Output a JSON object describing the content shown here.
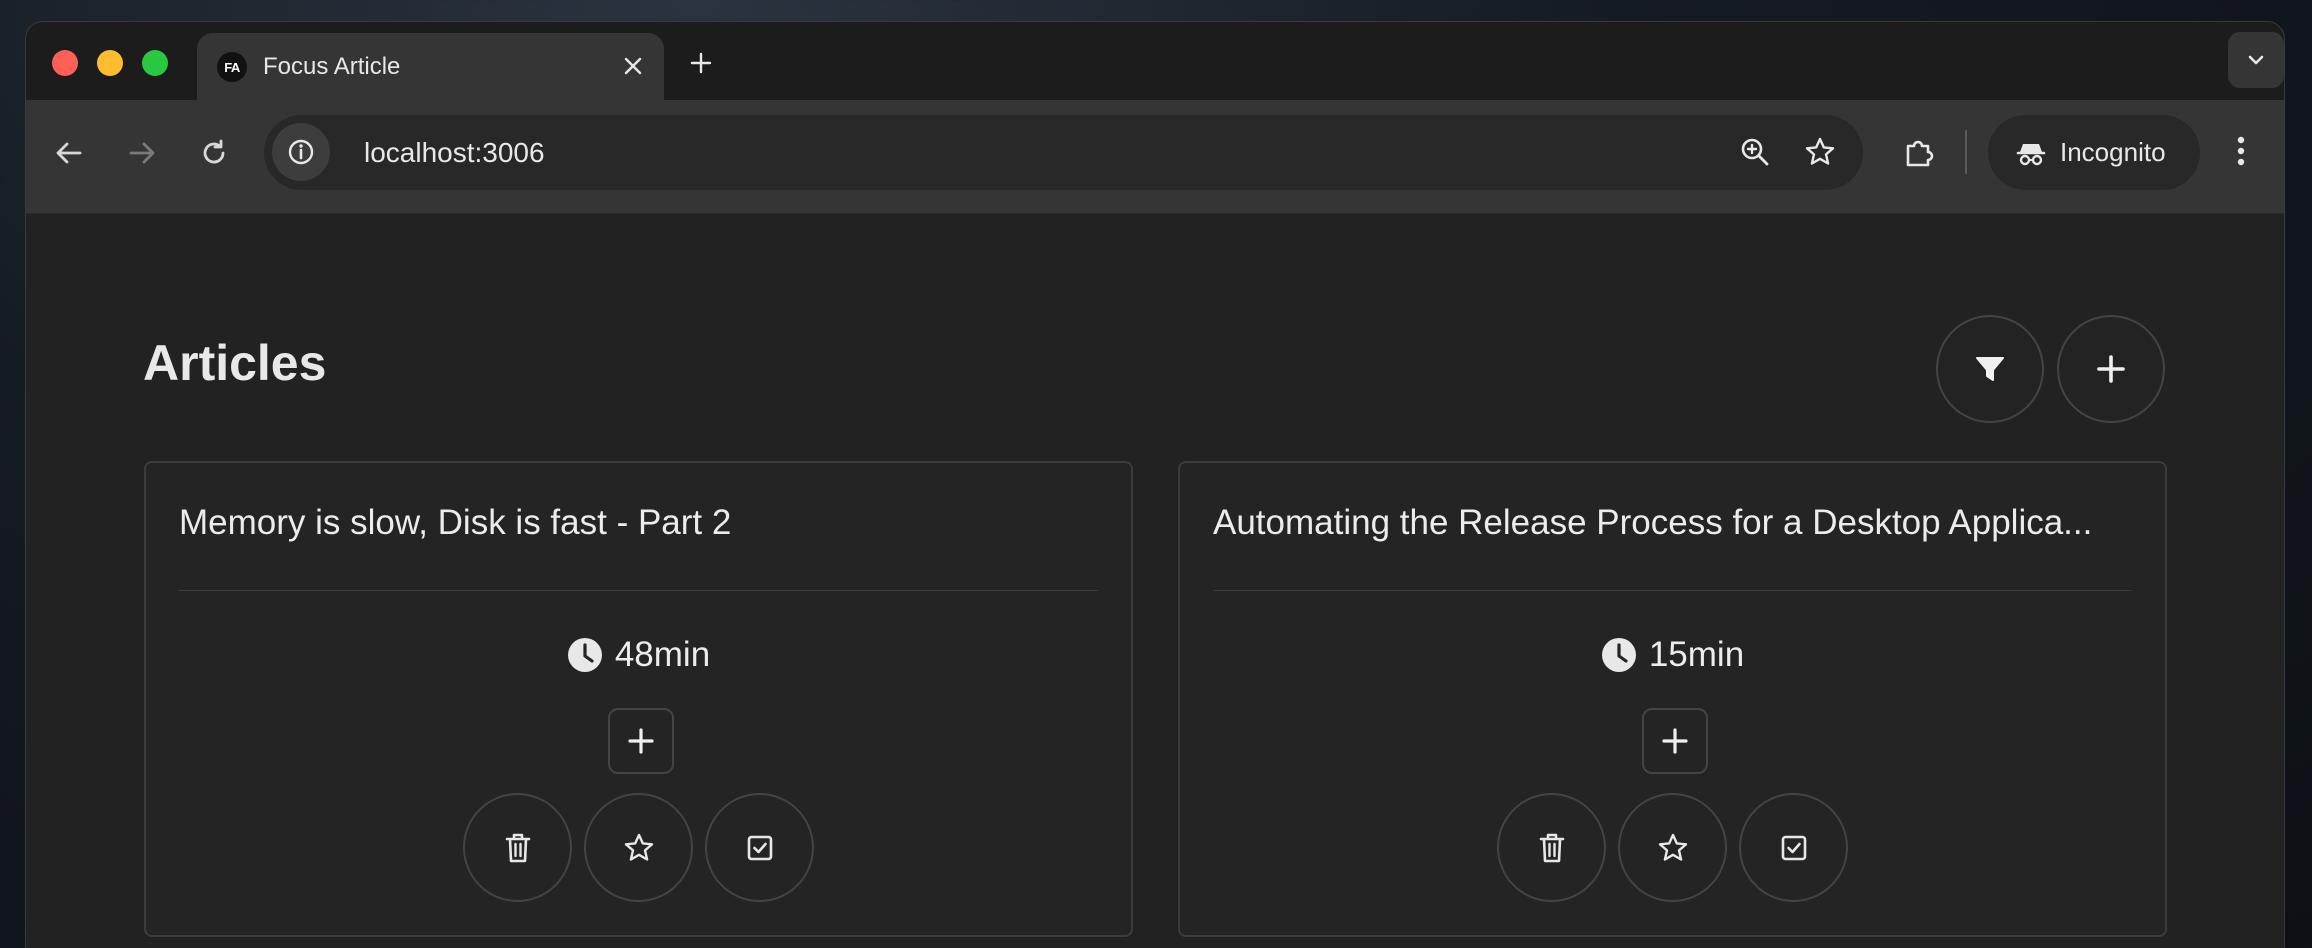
{
  "browser": {
    "tab": {
      "favicon_text": "FA",
      "title": "Focus Article"
    },
    "url": "localhost:3006",
    "profile_label": "Incognito"
  },
  "page": {
    "title": "Articles",
    "header_buttons": [
      {
        "name": "filter",
        "icon": "filter-icon"
      },
      {
        "name": "add",
        "icon": "plus-icon"
      }
    ]
  },
  "articles": [
    {
      "title": "Memory is slow, Disk is fast - Part 2",
      "read_time": "48min"
    },
    {
      "title": "Automating the Release Process for a Desktop Applica...",
      "read_time": "15min"
    }
  ],
  "colors": {
    "background": "#222222",
    "tab_bar": "#1c1c1c",
    "toolbar": "#353535",
    "card_border": "#3c3c3c",
    "text": "#ececec",
    "close_red": "#fe5f57",
    "minimize_yellow": "#febc2e",
    "maximize_green": "#28c840"
  }
}
